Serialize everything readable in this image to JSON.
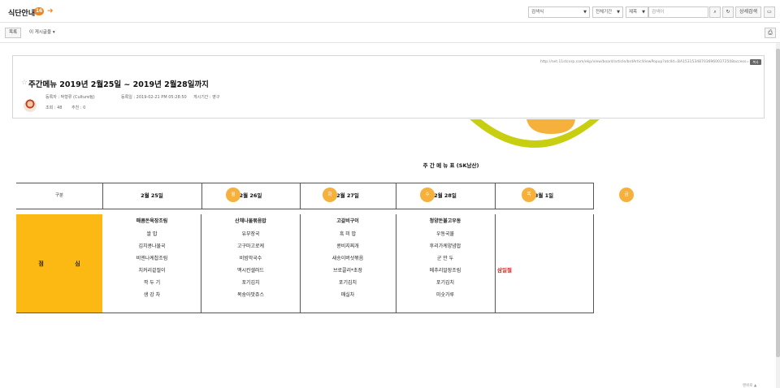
{
  "header": {
    "board_title": "식단안내",
    "count_badge": "16",
    "search_scope": "검색식",
    "period": "전체기간",
    "field": "제목",
    "search_placeholder": "검색어",
    "detail_search": "상세검색"
  },
  "toolbar": {
    "list_label": "목록",
    "move_label": "이 게시글을"
  },
  "article": {
    "url": "http://net.11stcorp.com/ekp/view/board/article/brdArticlViewPopup?atclId=BA1531534870369600372508access=",
    "copy_label": "복사",
    "title": "주간메뉴 2019년 2월25일 ~ 2019년 2월28일까지",
    "author": "등록자 : 박형류 (Culture팀)",
    "registered": "등록일 : 2019-02-21 PM 05:28:50",
    "period": "게시기간 : 영구",
    "views": "조회 : 48",
    "recommend": "추천 : 0"
  },
  "menu": {
    "title": "주 간 메 뉴 표 (SK남산)",
    "gubun_label": "구분",
    "lunch_label": "점 심",
    "days": [
      {
        "date": "2월 25일",
        "weekday": "월"
      },
      {
        "date": "2월 26일",
        "weekday": "화"
      },
      {
        "date": "2월 27일",
        "weekday": "수"
      },
      {
        "date": "2월 28일",
        "weekday": "목"
      },
      {
        "date": "3월 1일",
        "weekday": "금"
      }
    ],
    "columns": [
      [
        "매콤돈육장조림",
        "쌀 밥",
        "김치콩나물국",
        "비엔나케찹조림",
        "치커리겉절이",
        "깍 두 기",
        "생 강 차"
      ],
      [
        "산채나물볶음밥",
        "유부장국",
        "고구마고로케",
        "비빔막국수",
        "맥시칸샐러드",
        "포기김치",
        "복숭아맛쥬스"
      ],
      [
        "고갈비구이",
        "흑 미 밥",
        "콩비지찌개",
        "새송이버섯볶음",
        "브로콜리*초장",
        "포기김치",
        "매실차"
      ],
      [
        "청양돈불고우동",
        "우동국물",
        "후리가케양념밥",
        "군 만 두",
        "메추리알장조림",
        "포기김치",
        "미숫가루"
      ]
    ],
    "holiday": "삼일절"
  },
  "footer": {
    "corner_text": "맨위로 ▲"
  }
}
